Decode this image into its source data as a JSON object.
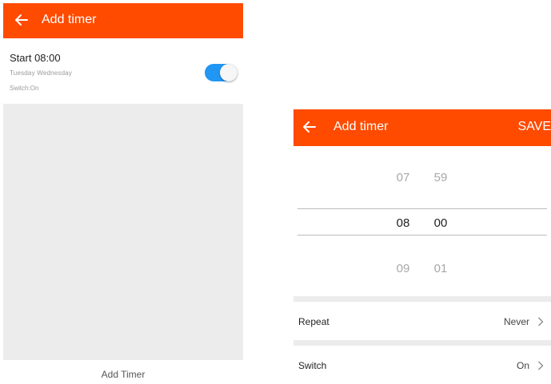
{
  "left": {
    "appbar": {
      "title": "Add timer"
    },
    "timer": {
      "start": "Start 08:00",
      "days": "Tuesday  Wednesday",
      "switch_status": "Switch:On",
      "enabled": true
    },
    "add_timer_label": "Add Timer"
  },
  "right": {
    "appbar": {
      "title": "Add timer",
      "save_label": "SAVE"
    },
    "picker": {
      "prev": {
        "hour": "07",
        "minute": "59"
      },
      "selected": {
        "hour": "08",
        "minute": "00"
      },
      "next": {
        "hour": "09",
        "minute": "01"
      }
    },
    "repeat": {
      "label": "Repeat",
      "value": "Never"
    },
    "switch": {
      "label": "Switch",
      "value": "On"
    }
  },
  "colors": {
    "appbar": "#ff4b00",
    "toggle_on": "#2196f3",
    "divider": "#ececec"
  },
  "icons": {
    "back": "arrow-left-icon",
    "chevron": "chevron-right-icon"
  }
}
